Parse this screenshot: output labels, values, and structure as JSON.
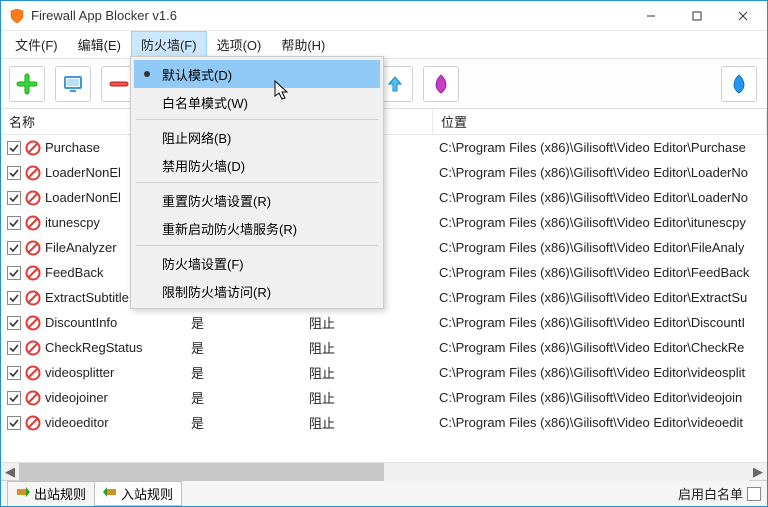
{
  "title": "Firewall App Blocker v1.6",
  "menubar": {
    "items": [
      "文件(F)",
      "编辑(E)",
      "防火墙(F)",
      "选项(O)",
      "帮助(H)"
    ],
    "activeIndex": 2
  },
  "dropdown": {
    "groups": [
      [
        {
          "label": "默认模式(D)",
          "selected": true,
          "checked": true
        },
        {
          "label": "白名单模式(W)"
        }
      ],
      [
        {
          "label": "阻止网络(B)"
        },
        {
          "label": "禁用防火墙(D)"
        }
      ],
      [
        {
          "label": "重置防火墙设置(R)"
        },
        {
          "label": "重新启动防火墙服务(R)"
        }
      ],
      [
        {
          "label": "防火墙设置(F)"
        },
        {
          "label": "限制防火墙访问(R)"
        }
      ]
    ]
  },
  "columns": {
    "name": "名称",
    "enabled_hidden": "",
    "action_hidden": "",
    "location": "位置"
  },
  "enabled_text": "是",
  "action_text": "阻止",
  "rows": [
    {
      "name": "Purchase",
      "path": "C:\\Program Files (x86)\\Gilisoft\\Video Editor\\Purchase"
    },
    {
      "name": "LoaderNonEl",
      "path": "C:\\Program Files (x86)\\Gilisoft\\Video Editor\\LoaderNo"
    },
    {
      "name": "LoaderNonEl",
      "path": "C:\\Program Files (x86)\\Gilisoft\\Video Editor\\LoaderNo"
    },
    {
      "name": "itunescpy",
      "path": "C:\\Program Files (x86)\\Gilisoft\\Video Editor\\itunescpy"
    },
    {
      "name": "FileAnalyzer",
      "path": "C:\\Program Files (x86)\\Gilisoft\\Video Editor\\FileAnaly"
    },
    {
      "name": "FeedBack",
      "path": "C:\\Program Files (x86)\\Gilisoft\\Video Editor\\FeedBack"
    },
    {
      "name": "ExtractSubtitle",
      "path": "C:\\Program Files (x86)\\Gilisoft\\Video Editor\\ExtractSu"
    },
    {
      "name": "DiscountInfo",
      "path": "C:\\Program Files (x86)\\Gilisoft\\Video Editor\\DiscountI"
    },
    {
      "name": "CheckRegStatus",
      "path": "C:\\Program Files (x86)\\Gilisoft\\Video Editor\\CheckRe"
    },
    {
      "name": "videosplitter",
      "path": "C:\\Program Files (x86)\\Gilisoft\\Video Editor\\videosplit"
    },
    {
      "name": "videojoiner",
      "path": "C:\\Program Files (x86)\\Gilisoft\\Video Editor\\videojoin"
    },
    {
      "name": "videoeditor",
      "path": "C:\\Program Files (x86)\\Gilisoft\\Video Editor\\videoedit"
    }
  ],
  "tabs": {
    "outbound": "出站规则",
    "inbound": "入站规则"
  },
  "whitelist_label": "启用白名单",
  "colw": {
    "name": 184,
    "enabled": 118,
    "action": 130,
    "location": 334
  }
}
